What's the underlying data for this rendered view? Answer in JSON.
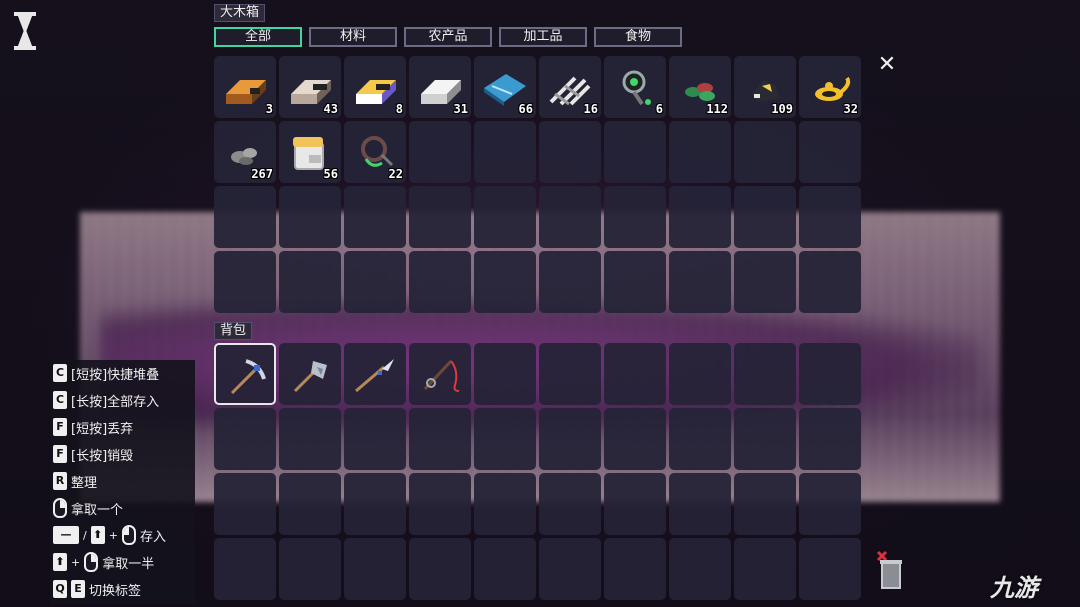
{
  "chest": {
    "title": "大木箱",
    "tabs": [
      {
        "label": "全部",
        "active": true
      },
      {
        "label": "材料",
        "active": false
      },
      {
        "label": "农产品",
        "active": false
      },
      {
        "label": "加工品",
        "active": false
      },
      {
        "label": "食物",
        "active": false
      }
    ],
    "close_glyph": "✕",
    "items": [
      {
        "icon": "copper-bar-icon",
        "count": "3"
      },
      {
        "icon": "iron-bar-icon",
        "count": "43"
      },
      {
        "icon": "gold-bar-icon",
        "count": "8"
      },
      {
        "icon": "silver-bar-icon",
        "count": "31"
      },
      {
        "icon": "blue-cloth-icon",
        "count": "66"
      },
      {
        "icon": "rail-icon",
        "count": "16"
      },
      {
        "icon": "green-gem-orb-icon",
        "count": "6"
      },
      {
        "icon": "green-leaves-icon",
        "count": "112"
      },
      {
        "icon": "dark-ore-icon",
        "count": "109"
      },
      {
        "icon": "gold-lamp-icon",
        "count": "32"
      },
      {
        "icon": "stone-icon",
        "count": "267"
      },
      {
        "icon": "paper-stack-icon",
        "count": "56"
      },
      {
        "icon": "vine-icon",
        "count": "22"
      }
    ],
    "total_slots": 40
  },
  "backpack": {
    "title": "背包",
    "items": [
      {
        "icon": "pickaxe-icon",
        "count": "",
        "selected": true
      },
      {
        "icon": "axe-icon",
        "count": "",
        "selected": false
      },
      {
        "icon": "spear-icon",
        "count": "",
        "selected": false
      },
      {
        "icon": "fishing-rod-icon",
        "count": "",
        "selected": false
      }
    ],
    "total_slots": 40
  },
  "hints": [
    {
      "keys": [
        "C"
      ],
      "text": "[短按]快捷堆叠"
    },
    {
      "keys": [
        "C"
      ],
      "text": "[长按]全部存入"
    },
    {
      "keys": [
        "F"
      ],
      "text": "[短按]丢弃"
    },
    {
      "keys": [
        "F"
      ],
      "text": "[长按]销毁"
    },
    {
      "keys": [
        "R"
      ],
      "text": "整理"
    },
    {
      "keys": [
        "mouse-right"
      ],
      "text": "拿取一个"
    },
    {
      "keys": [
        "space",
        "/",
        "shift",
        "+",
        "mouse-left"
      ],
      "text": "存入"
    },
    {
      "keys": [
        "shift",
        "+",
        "mouse-right"
      ],
      "text": "拿取一半"
    },
    {
      "keys": [
        "Q",
        "E"
      ],
      "text": "切换标签"
    }
  ],
  "watermark": "九游",
  "colors": {
    "active_tab": "#3fd6a2",
    "slot": "#252337",
    "text": "#f0f0f0"
  }
}
